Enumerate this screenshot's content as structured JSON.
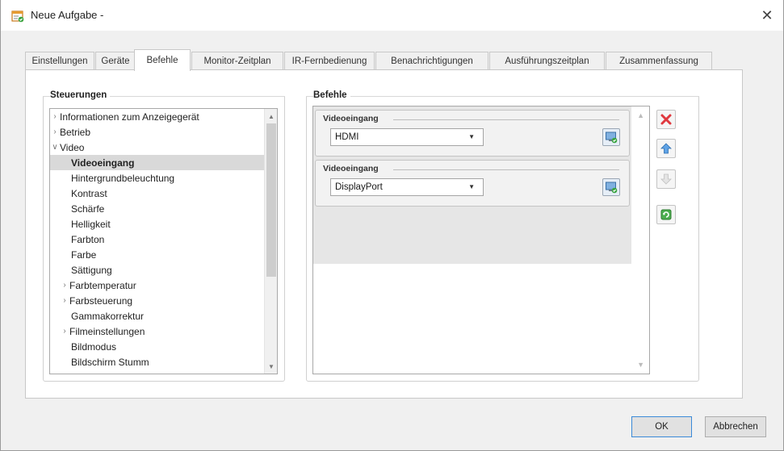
{
  "window": {
    "title": "Neue Aufgabe -",
    "close_label": "✕"
  },
  "tabs": [
    {
      "label": "Einstellungen",
      "active": false
    },
    {
      "label": "Geräte",
      "active": false
    },
    {
      "label": "Befehle",
      "active": true
    },
    {
      "label": "Monitor-Zeitplan",
      "active": false
    },
    {
      "label": "IR-Fernbedienung",
      "active": false
    },
    {
      "label": "Benachrichtigungen",
      "active": false
    },
    {
      "label": "Ausführungszeitplan",
      "active": false
    },
    {
      "label": "Zusammenfassung",
      "active": false
    }
  ],
  "controls_group": {
    "title": "Steuerungen",
    "items": [
      {
        "label": "Informationen zum Anzeigegerät",
        "arrow": "›",
        "selected": false
      },
      {
        "label": "Betrieb",
        "arrow": "›",
        "selected": false
      },
      {
        "label": "Video",
        "arrow": "∨",
        "selected": false
      },
      {
        "label": "Videoeingang",
        "arrow": "",
        "selected": true
      },
      {
        "label": "Hintergrundbeleuchtung",
        "arrow": "",
        "selected": false
      },
      {
        "label": "Kontrast",
        "arrow": "",
        "selected": false
      },
      {
        "label": "Schärfe",
        "arrow": "",
        "selected": false
      },
      {
        "label": "Helligkeit",
        "arrow": "",
        "selected": false
      },
      {
        "label": "Farbton",
        "arrow": "",
        "selected": false
      },
      {
        "label": "Farbe",
        "arrow": "",
        "selected": false
      },
      {
        "label": "Sättigung",
        "arrow": "",
        "selected": false
      },
      {
        "label": "Farbtemperatur",
        "arrow": "›",
        "selected": false
      },
      {
        "label": "Farbsteuerung",
        "arrow": "›",
        "selected": false
      },
      {
        "label": "Gammakorrektur",
        "arrow": "",
        "selected": false
      },
      {
        "label": "Filmeinstellungen",
        "arrow": "›",
        "selected": false
      },
      {
        "label": "Bildmodus",
        "arrow": "",
        "selected": false
      },
      {
        "label": "Bildschirm Stumm",
        "arrow": "",
        "selected": false
      }
    ]
  },
  "commands_group": {
    "title": "Befehle",
    "commands": [
      {
        "legend": "Videoeingang",
        "value": "HDMI"
      },
      {
        "legend": "Videoeingang",
        "value": "DisplayPort"
      }
    ]
  },
  "side_buttons": [
    {
      "icon": "delete-icon",
      "enabled": true
    },
    {
      "icon": "move-up-icon",
      "enabled": true
    },
    {
      "icon": "move-down-icon",
      "enabled": false
    },
    {
      "icon": "refresh-icon",
      "enabled": true
    }
  ],
  "footer": {
    "ok_label": "OK",
    "cancel_label": "Abbrechen"
  }
}
